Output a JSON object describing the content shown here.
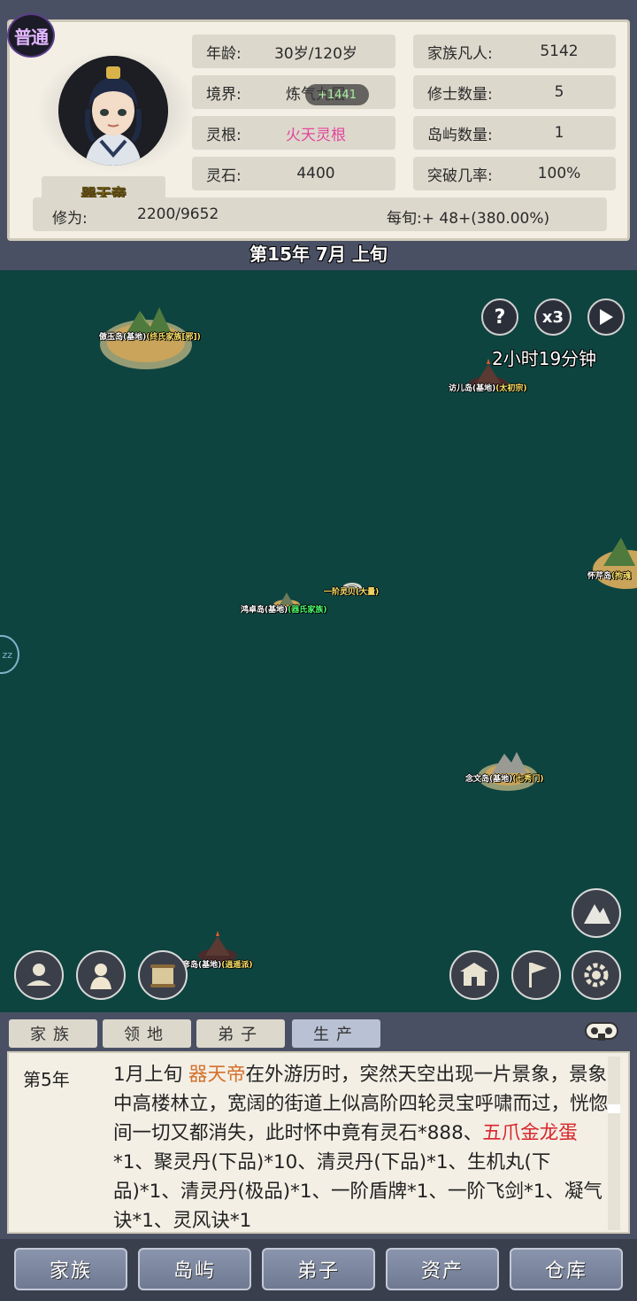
{
  "header": {
    "grade_badge": "普通",
    "name": "器天帝",
    "age_label": "年龄:",
    "age_value": "30岁/120岁",
    "realm_label": "境界:",
    "realm_value": "炼气九层",
    "root_label": "灵根:",
    "root_value": "火天灵根",
    "stone_label": "灵石:",
    "stone_value": "4400",
    "mortals_label": "家族凡人:",
    "mortals_value": "5142",
    "cultivators_label": "修士数量:",
    "cultivators_value": "5",
    "islands_label": "岛屿数量:",
    "islands_value": "1",
    "breakthrough_label": "突破几率:",
    "breakthrough_value": "100%",
    "exp_label": "修为:",
    "exp_value": "2200/9652",
    "rate_text": "每旬:+ 48+(380.00%)",
    "tooltip_value": "+1441"
  },
  "date": "第15年 7月 上旬",
  "map": {
    "timer": "2小时19分钟",
    "speed_label": "x3",
    "help_label": "?",
    "edge_label": "zz",
    "islands": [
      {
        "name": "傲玉岛(基地)",
        "sect": "(终氏家族[邪])",
        "color": "yellow"
      },
      {
        "name": "访儿岛(基地)",
        "sect": "(太初宗)",
        "color": "yellow"
      },
      {
        "name": "怀芹岛",
        "sect": "(拘魂",
        "color": "yellow"
      },
      {
        "name": "一阶灵贝(大量)",
        "sect": "",
        "color": "yellow"
      },
      {
        "name": "鸿卓岛(基地)",
        "sect": "(器氏家族)",
        "color": "green"
      },
      {
        "name": "念文岛(基地)",
        "sect": "(七秀门)",
        "color": "yellow"
      },
      {
        "name": "彦岛(基地)",
        "sect": "(逍遥派)",
        "color": "yellow"
      }
    ]
  },
  "tabs": [
    "家族",
    "领地",
    "弟子",
    "生产"
  ],
  "log": {
    "year": "第5年",
    "seg1": "1月上旬 ",
    "seg2": "器天帝",
    "seg3": "在外游历时，突然天空出现一片景象，景象中高楼林立，宽阔的街道上似高阶四轮灵宝呼啸而过，恍惚间一切又都消失，此时怀中竟有灵石*888、",
    "seg4": "五爪金龙蛋",
    "seg5": "*1、聚灵丹(下品)*10、清灵丹(下品)*1、生机丸(下品)*1、清灵丹(极品)*1、一阶盾牌*1、一阶飞剑*1、凝气诀*1、灵风诀*1"
  },
  "nav": [
    "家族",
    "岛屿",
    "弟子",
    "资产",
    "仓库"
  ],
  "colors": {
    "sea": "#0e4440",
    "panel": "#f3efe5",
    "frame": "#4a5064",
    "root_pink": "#e2479d",
    "name_gold": "#e9c63b"
  }
}
